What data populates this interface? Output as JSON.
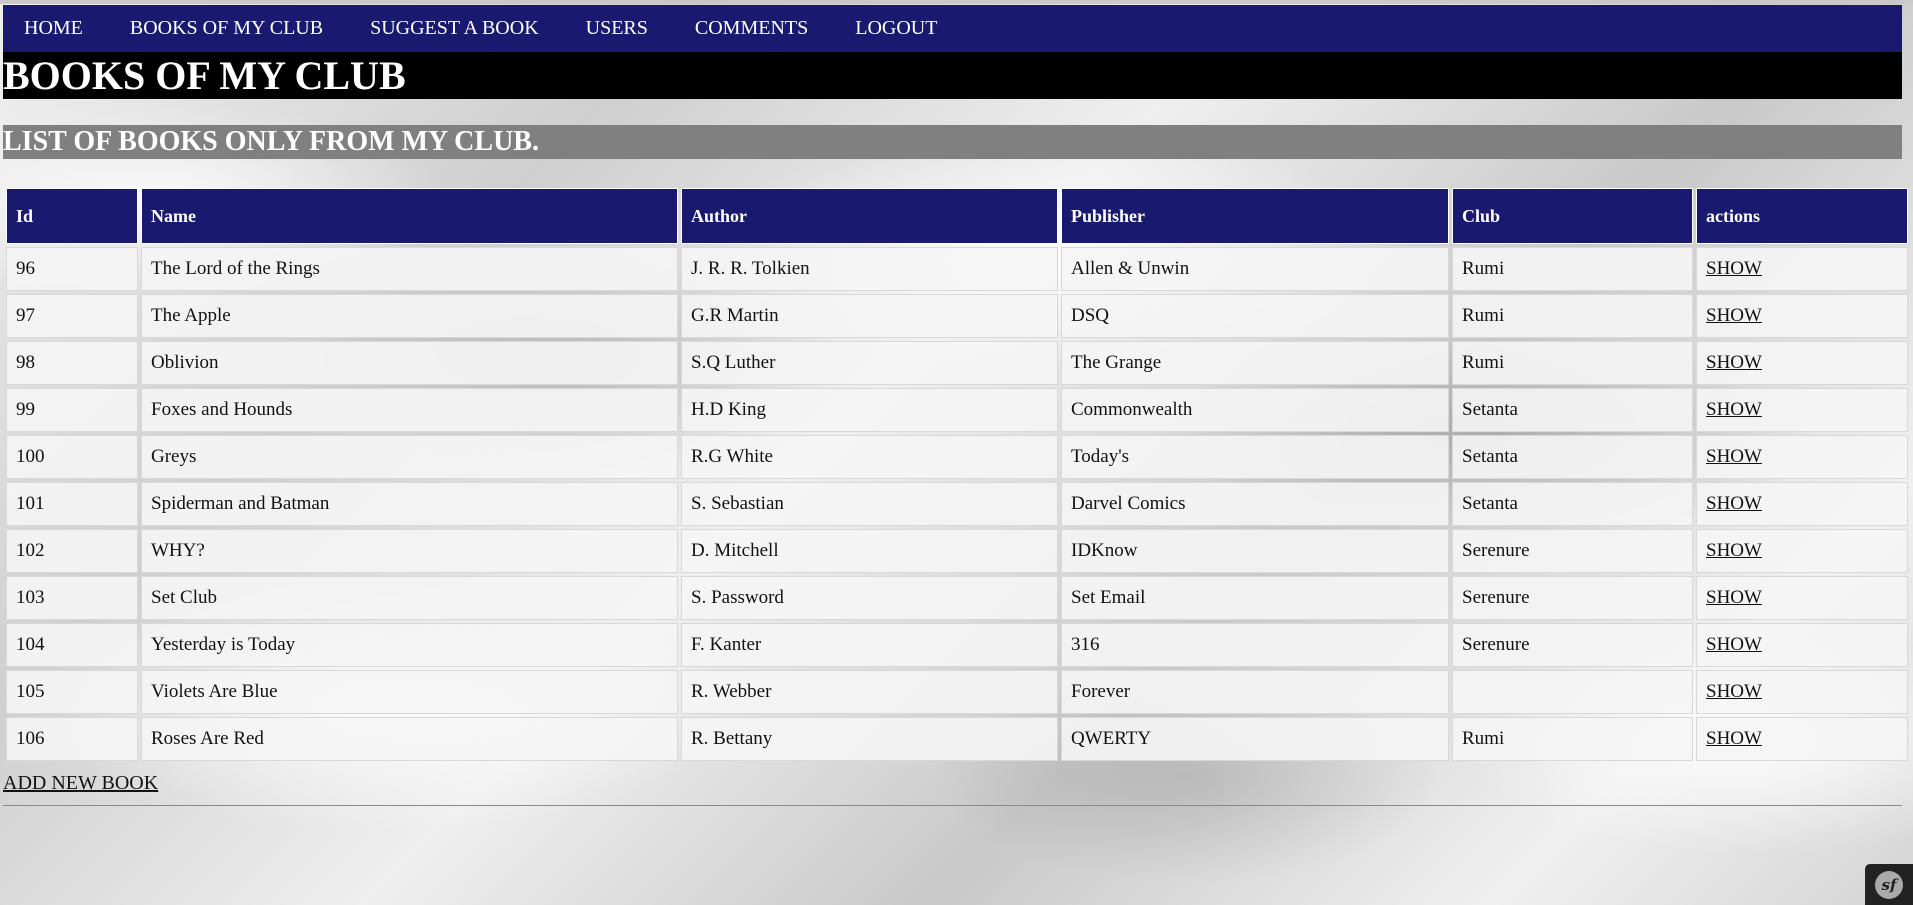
{
  "nav": {
    "items": [
      {
        "label": "HOME"
      },
      {
        "label": "BOOKS OF MY CLUB"
      },
      {
        "label": "SUGGEST A BOOK"
      },
      {
        "label": "USERS"
      },
      {
        "label": "COMMENTS"
      },
      {
        "label": "LOGOUT"
      }
    ]
  },
  "page_title": "BOOKS OF MY CLUB",
  "subtitle": "LIST OF BOOKS ONLY FROM MY CLUB.",
  "table": {
    "headers": [
      "Id",
      "Name",
      "Author",
      "Publisher",
      "Club",
      "actions"
    ],
    "rows": [
      {
        "id": "96",
        "name": "The Lord of the Rings",
        "author": "J. R. R. Tolkien",
        "publisher": "Allen & Unwin",
        "club": "Rumi",
        "action": "SHOW"
      },
      {
        "id": "97",
        "name": "The Apple",
        "author": "G.R Martin",
        "publisher": "DSQ",
        "club": "Rumi",
        "action": "SHOW"
      },
      {
        "id": "98",
        "name": "Oblivion",
        "author": "S.Q Luther",
        "publisher": "The Grange",
        "club": "Rumi",
        "action": "SHOW"
      },
      {
        "id": "99",
        "name": "Foxes and Hounds",
        "author": "H.D King",
        "publisher": "Commonwealth",
        "club": "Setanta",
        "action": "SHOW"
      },
      {
        "id": "100",
        "name": "Greys",
        "author": "R.G White",
        "publisher": "Today's",
        "club": "Setanta",
        "action": "SHOW"
      },
      {
        "id": "101",
        "name": "Spiderman and Batman",
        "author": "S. Sebastian",
        "publisher": "Darvel Comics",
        "club": "Setanta",
        "action": "SHOW"
      },
      {
        "id": "102",
        "name": "WHY?",
        "author": "D. Mitchell",
        "publisher": "IDKnow",
        "club": "Serenure",
        "action": "SHOW"
      },
      {
        "id": "103",
        "name": "Set Club",
        "author": "S. Password",
        "publisher": "Set Email",
        "club": "Serenure",
        "action": "SHOW"
      },
      {
        "id": "104",
        "name": "Yesterday is Today",
        "author": "F. Kanter",
        "publisher": "316",
        "club": "Serenure",
        "action": "SHOW"
      },
      {
        "id": "105",
        "name": "Violets Are Blue",
        "author": "R. Webber",
        "publisher": "Forever",
        "club": "",
        "action": "SHOW"
      },
      {
        "id": "106",
        "name": "Roses Are Red",
        "author": "R. Bettany",
        "publisher": "QWERTY",
        "club": "Rumi",
        "action": "SHOW"
      }
    ]
  },
  "add_link": "ADD NEW BOOK",
  "toolbar_badge": {
    "icon": "symfony-icon",
    "text": "sf"
  },
  "colors": {
    "nav_bg": "#191970",
    "title_bg": "#000000",
    "subtitle_bg": "#808080",
    "header_bg": "#191970"
  }
}
